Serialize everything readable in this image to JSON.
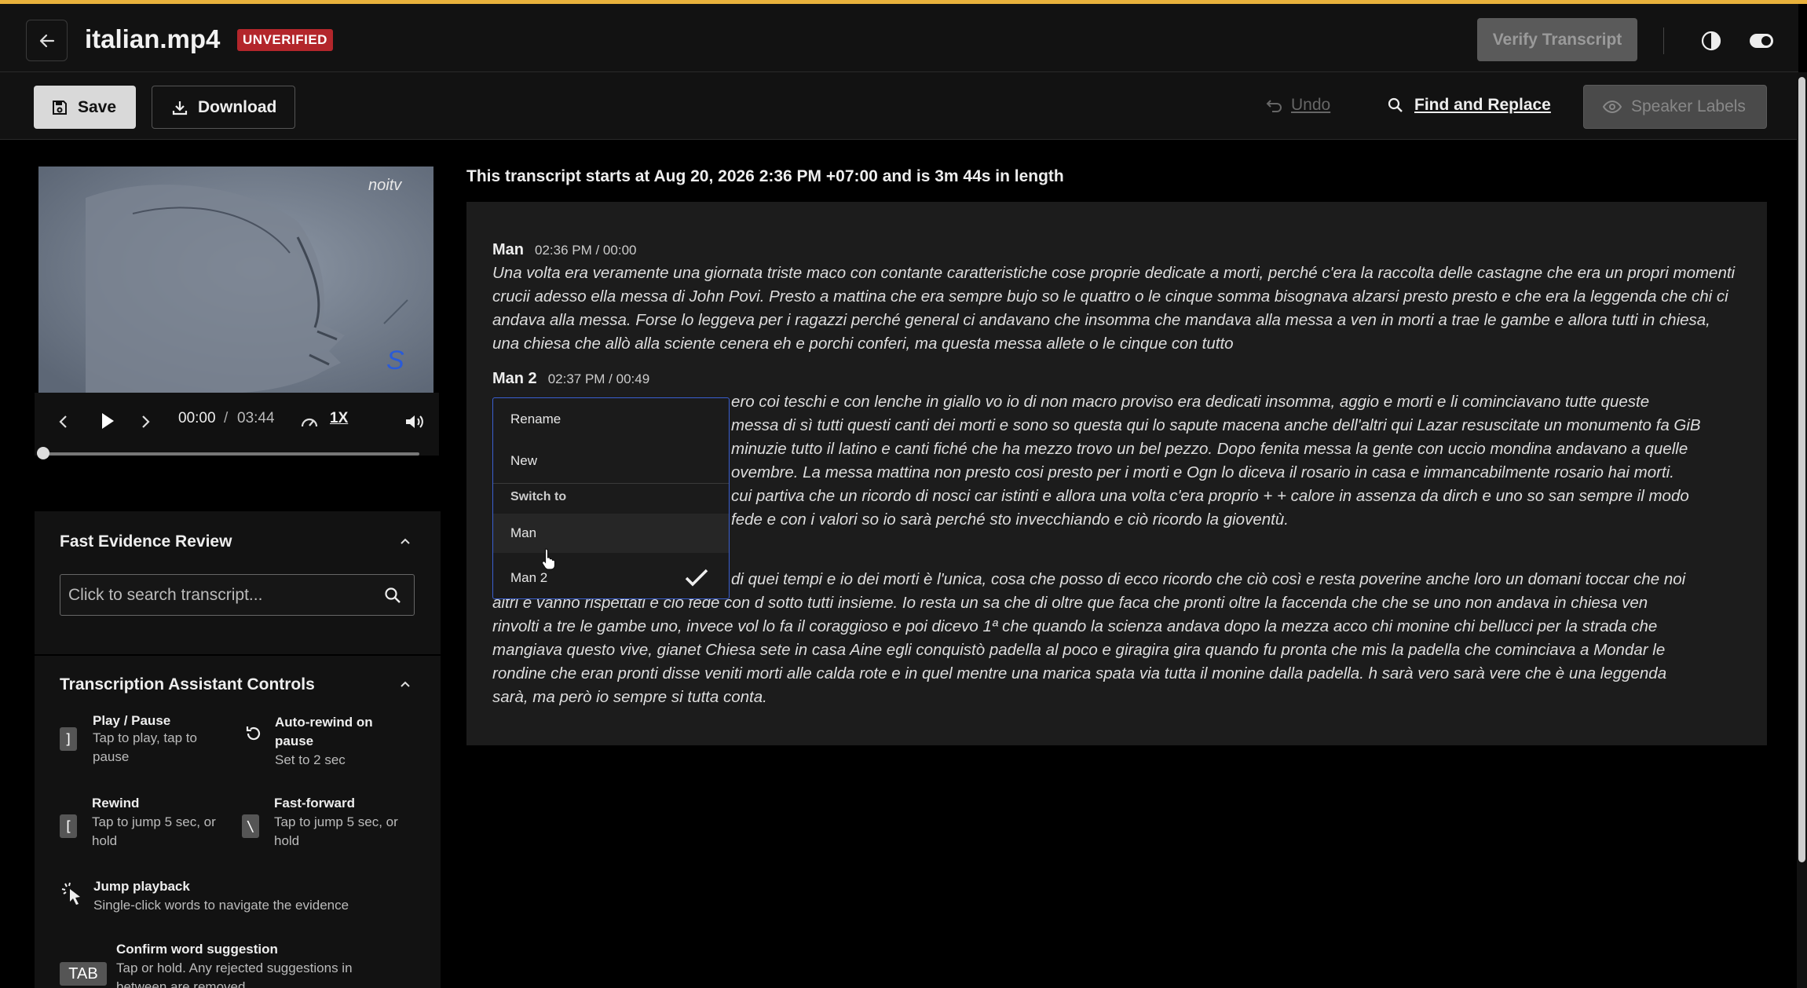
{
  "header": {
    "file_name": "italian.mp4",
    "status_badge": "UNVERIFIED",
    "verify_label": "Verify Transcript"
  },
  "toolbar": {
    "save_label": "Save",
    "download_label": "Download",
    "undo_label": "Undo",
    "find_replace_label": "Find and Replace",
    "speaker_labels_label": "Speaker Labels"
  },
  "player": {
    "current_time": "00:00",
    "separator": "/",
    "duration": "03:44",
    "speed": "1X",
    "progress": 0.0,
    "watermark": "noitv"
  },
  "fast_evidence": {
    "title": "Fast Evidence Review",
    "search_placeholder": "Click to search transcript..."
  },
  "assistant": {
    "title": "Transcription Assistant Controls",
    "controls": [
      {
        "key": "]",
        "name": "Play / Pause",
        "desc": "Tap to play, tap to pause"
      },
      {
        "name": "Auto-rewind on pause",
        "desc": "Set to 2 sec"
      },
      {
        "key": "[",
        "name": "Rewind",
        "desc": "Tap to jump 5 sec, or hold"
      },
      {
        "key": "\\",
        "name": "Fast-forward",
        "desc": "Tap to jump 5 sec, or hold"
      },
      {
        "name": "Jump playback",
        "desc": "Single-click words to navigate the evidence"
      },
      {
        "key": "TAB",
        "name": "Confirm word suggestion",
        "desc": "Tap or hold. Any rejected suggestions in between are removed"
      }
    ]
  },
  "transcript": {
    "info": "This transcript starts at Aug 20, 2026 2:36 PM +07:00 and is 3m 44s in length",
    "segments": [
      {
        "speaker": "Man",
        "time": "02:36 PM / 00:00",
        "text": "Una volta era veramente una giornata triste maco con contante caratteristiche cose proprie dedicate a morti, perché c'era la raccolta delle castagne che era un propri momenti crucii adesso ella messa di John Povi. Presto a mattina che era sempre bujo so le quattro o le cinque somma bisognava alzarsi presto presto e che era la leggenda che chi ci andava alla messa. Forse lo leggeva per i ragazzi perché general ci andavano che insomma che mandava alla messa a ven in morti a trae le gambe e allora tutti in chiesa, una chiesa che allò alla sciente cenera eh e porchi conferi, ma questa messa allete o le cinque con tutto"
      },
      {
        "speaker": "Man 2",
        "time": "02:37 PM / 00:49",
        "lines": [
          "ero coi teschi e con lenche in giallo vo io di non macro proviso era dedicati insomma, aggio e morti e li cominciavano tutte queste",
          "messa di sì tutti questi canti dei morti e sono so questa qui lo sapute macena anche dell'altri qui Lazar resuscitate un monumento fa GiB",
          "minuzie tutto il latino e canti fiché che ha mezzo trovo un bel pezzo. Dopo fenita messa la gente con uccio mondina andavano a quelle",
          "ovembre. La messa mattina non presto cosi presto per i morti e Ogn lo diceva il rosario in casa e immancabilmente rosario hai morti.",
          "cui partiva che un ricordo di nosci car istinti e allora una volta c'era proprio + + calore in assenza da dirch e uno so san sempre il modo",
          "fede e con i valori so io sarà perché sto invecchiando e ciò ricordo la gioventù."
        ]
      },
      {
        "lines": [
          "di quei tempi e io dei morti è l'unica, cosa che posso di ecco ricordo che ciò così e resta poverine anche loro un domani toccar che noi",
          "altri e vanno rispettati e ciò fede con d sotto tutti insieme. Io resta un sa che di oltre que faca che pronti oltre la faccenda che che se uno non andava in chiesa ven",
          "rinvolti a tre le gambe uno, invece vol lo fa il coraggioso e poi dicevo 1ª che quando la scienza andava dopo la mezza acco chi monine chi bellucci per la strada che",
          "mangiava questo vive, gianet Chiesa sete in casa Aine egli conquistò padella al poco e giragira gira quando fu pronta che mis la padella che cominciava a Mondar le",
          "rondine che eran pronti disse veniti morti alle calda rote e in quel mentre una marica spata via tutta il monine dalla padella. h sarà vero sarà vere che è una leggenda",
          "sarà, ma però io sempre si tutta conta."
        ]
      }
    ]
  },
  "speaker_menu": {
    "rename": "Rename",
    "new": "New",
    "section": "Switch to",
    "options": [
      "Man",
      "Man 2"
    ],
    "selected": "Man 2"
  },
  "colors": {
    "accent_line": "#e9b23c",
    "badge_red": "#b3262b",
    "dropdown_border": "#3a5fd0"
  }
}
